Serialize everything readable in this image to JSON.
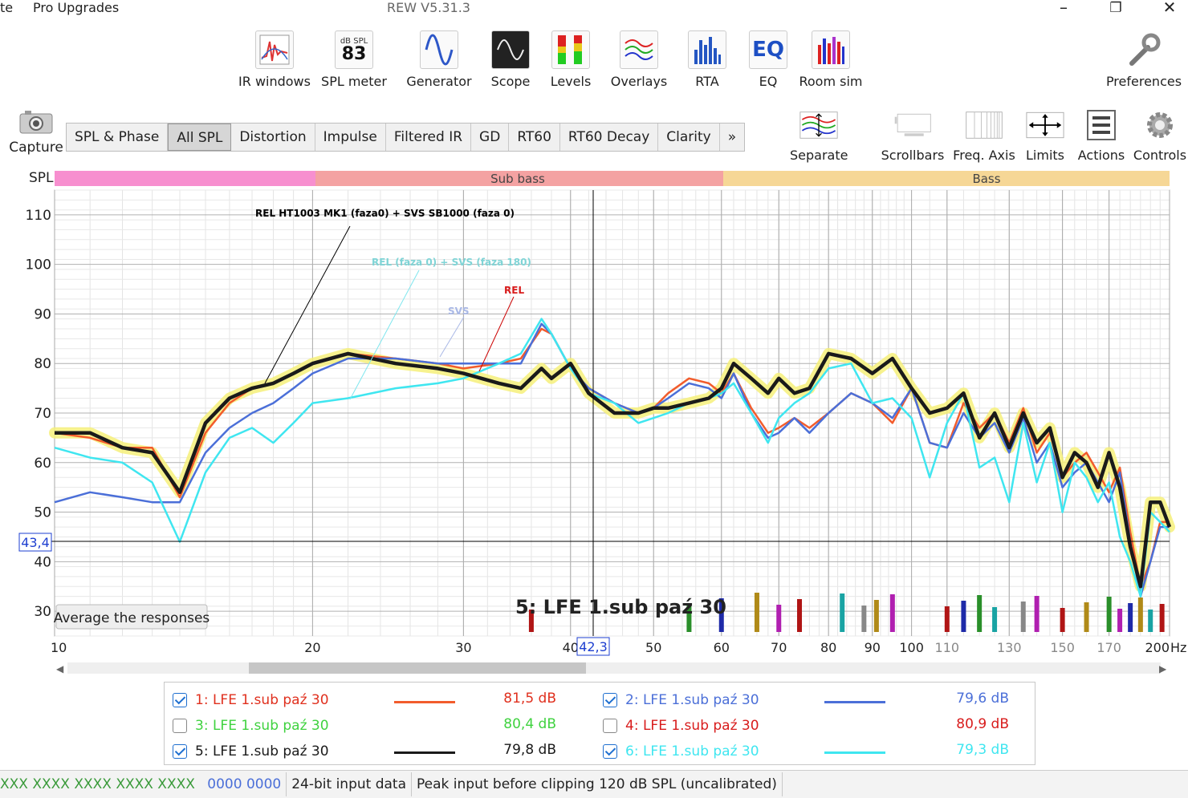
{
  "window": {
    "title": "REW V5.31.3",
    "menu": [
      "te",
      "Pro Upgrades"
    ],
    "controls": {
      "minimize": "–",
      "restore": "❐",
      "close": "✕"
    }
  },
  "toolbar": [
    {
      "label": "IR windows",
      "icon": "ir-windows-icon"
    },
    {
      "label": "SPL meter",
      "icon": "spl-meter-icon",
      "badge_top": "dB SPL",
      "badge_value": "83"
    },
    {
      "label": "Generator",
      "icon": "generator-icon"
    },
    {
      "label": "Scope",
      "icon": "scope-icon"
    },
    {
      "label": "Levels",
      "icon": "levels-icon"
    },
    {
      "label": "Overlays",
      "icon": "overlays-icon"
    },
    {
      "label": "RTA",
      "icon": "rta-icon"
    },
    {
      "label": "EQ",
      "icon": "eq-icon",
      "badge_value": "EQ"
    },
    {
      "label": "Room sim",
      "icon": "room-sim-icon"
    }
  ],
  "preferences_label": "Preferences",
  "capture_label": "Capture",
  "tabs": [
    "SPL & Phase",
    "All SPL",
    "Distortion",
    "Impulse",
    "Filtered IR",
    "GD",
    "RT60",
    "RT60 Decay",
    "Clarity",
    "»"
  ],
  "active_tab": "All SPL",
  "right_tools": [
    {
      "label": "Separate",
      "icon": "separate-icon"
    },
    {
      "label": "Scrollbars",
      "icon": "scrollbars-icon"
    },
    {
      "label": "Freq. Axis",
      "icon": "freq-axis-icon"
    },
    {
      "label": "Limits",
      "icon": "limits-icon"
    },
    {
      "label": "Actions",
      "icon": "actions-icon"
    },
    {
      "label": "Controls",
      "icon": "controls-icon"
    }
  ],
  "graph": {
    "y_axis_title": "SPL",
    "bands": [
      {
        "label": "",
        "color": "#f78fcf"
      },
      {
        "label": "Sub bass",
        "color": "#f4a2a2"
      },
      {
        "label": "Bass",
        "color": "#f6d796"
      }
    ],
    "cursor_y": "43,4",
    "cursor_x": "42,3",
    "average_button": "Average the responses",
    "trace_label": "5: LFE 1.sub paź 30",
    "annotations": [
      {
        "text": "REL HT1003 MK1 (faza0) + SVS SB1000 (faza 0)",
        "color": "#000000"
      },
      {
        "text": "REL (faza 0) + SVS (faza 180)",
        "color": "#7fd4d6"
      },
      {
        "text": "SVS",
        "color": "#a9b8e6"
      },
      {
        "text": "REL",
        "color": "#d81c1c"
      }
    ],
    "hz_unit": "Hz"
  },
  "chart_data": {
    "type": "line",
    "xlabel": "",
    "ylabel": "SPL",
    "x_scale": "log",
    "xlim": [
      10,
      200
    ],
    "ylim": [
      25,
      115
    ],
    "x_ticks": [
      {
        "v": 10,
        "label": "10"
      },
      {
        "v": 20,
        "label": "20"
      },
      {
        "v": 30,
        "label": "30"
      },
      {
        "v": 40,
        "label": "40"
      },
      {
        "v": 50,
        "label": "50"
      },
      {
        "v": 60,
        "label": "60"
      },
      {
        "v": 70,
        "label": "70"
      },
      {
        "v": 80,
        "label": "80"
      },
      {
        "v": 90,
        "label": "90"
      },
      {
        "v": 100,
        "label": "100"
      },
      {
        "v": 110,
        "label": "110"
      },
      {
        "v": 130,
        "label": "130"
      },
      {
        "v": 150,
        "label": "150"
      },
      {
        "v": 170,
        "label": "170"
      },
      {
        "v": 200,
        "label": "200"
      }
    ],
    "y_ticks": [
      30,
      40,
      50,
      60,
      70,
      80,
      90,
      100,
      110
    ],
    "grid": true,
    "series": [
      {
        "name": "1: LFE 1.sub paź 30",
        "color": "#f25c2c",
        "x": [
          10,
          11,
          12,
          13,
          14,
          15,
          16,
          17,
          18,
          19,
          20,
          22,
          25,
          28,
          30,
          33,
          35,
          37,
          38,
          40,
          42,
          45,
          48,
          50,
          52,
          55,
          58,
          60,
          62,
          65,
          68,
          70,
          73,
          76,
          80,
          85,
          90,
          95,
          100,
          105,
          110,
          115,
          120,
          125,
          130,
          135,
          140,
          145,
          150,
          155,
          160,
          165,
          170,
          175,
          180,
          185,
          190,
          195,
          200
        ],
        "y": [
          66,
          65,
          63,
          63,
          53,
          66,
          72,
          75,
          76,
          78,
          80,
          82,
          81,
          80,
          79,
          80,
          81,
          87,
          86,
          79,
          75,
          72,
          70,
          71,
          74,
          77,
          76,
          74,
          78,
          71,
          66,
          67,
          69,
          67,
          70,
          74,
          72,
          68,
          75,
          64,
          63,
          72,
          67,
          70,
          64,
          71,
          62,
          66,
          57,
          60,
          62,
          58,
          54,
          59,
          46,
          35,
          40,
          48,
          48
        ]
      },
      {
        "name": "2: LFE 1.sub paź 30",
        "color": "#4b6fd8",
        "x": [
          10,
          11,
          12,
          13,
          14,
          15,
          16,
          17,
          18,
          19,
          20,
          22,
          25,
          28,
          30,
          33,
          35,
          37,
          38,
          40,
          42,
          45,
          48,
          50,
          52,
          55,
          58,
          60,
          62,
          65,
          68,
          70,
          73,
          76,
          80,
          85,
          90,
          95,
          100,
          105,
          110,
          115,
          120,
          125,
          130,
          135,
          140,
          145,
          150,
          155,
          160,
          165,
          170,
          175,
          180,
          185,
          190,
          195,
          200
        ],
        "y": [
          52,
          54,
          53,
          52,
          52,
          62,
          67,
          70,
          72,
          75,
          78,
          81,
          81,
          80,
          80,
          80,
          80,
          88,
          86,
          79,
          75,
          72,
          70,
          71,
          73,
          76,
          75,
          73,
          78,
          70,
          65,
          66,
          69,
          66,
          70,
          74,
          72,
          69,
          75,
          64,
          63,
          70,
          65,
          68,
          62,
          69,
          60,
          64,
          55,
          58,
          60,
          56,
          52,
          58,
          44,
          33,
          40,
          47,
          47
        ]
      },
      {
        "name": "3: LFE 1.sub paź 30",
        "color": "#3fd23f",
        "hidden": true,
        "x": [],
        "y": []
      },
      {
        "name": "4: LFE 1.sub paź 30",
        "color": "#d81c1c",
        "hidden": true,
        "x": [],
        "y": []
      },
      {
        "name": "5: LFE 1.sub paź 30",
        "color": "#1a1a1a",
        "x": [
          10,
          11,
          12,
          13,
          14,
          15,
          16,
          17,
          18,
          19,
          20,
          22,
          25,
          28,
          30,
          33,
          35,
          37,
          38,
          40,
          42,
          45,
          48,
          50,
          52,
          55,
          58,
          60,
          62,
          65,
          68,
          70,
          73,
          76,
          80,
          85,
          90,
          95,
          100,
          105,
          110,
          115,
          120,
          125,
          130,
          135,
          140,
          145,
          150,
          155,
          160,
          165,
          170,
          175,
          180,
          185,
          190,
          195,
          200
        ],
        "y": [
          66,
          66,
          63,
          62,
          54,
          68,
          73,
          75,
          76,
          78,
          80,
          82,
          80,
          79,
          78,
          76,
          75,
          79,
          77,
          80,
          74,
          70,
          70,
          71,
          71,
          72,
          73,
          75,
          80,
          77,
          74,
          77,
          74,
          75,
          82,
          81,
          78,
          81,
          75,
          70,
          71,
          74,
          65,
          70,
          63,
          70,
          64,
          67,
          57,
          62,
          60,
          55,
          62,
          55,
          43,
          35,
          52,
          52,
          47
        ]
      },
      {
        "name": "6: LFE 1.sub paź 30",
        "color": "#3fe6f0",
        "x": [
          10,
          11,
          12,
          13,
          14,
          15,
          16,
          17,
          18,
          19,
          20,
          22,
          25,
          28,
          30,
          33,
          35,
          37,
          38,
          40,
          42,
          45,
          48,
          50,
          52,
          55,
          58,
          60,
          62,
          65,
          68,
          70,
          73,
          76,
          80,
          85,
          90,
          95,
          100,
          105,
          110,
          115,
          120,
          125,
          130,
          135,
          140,
          145,
          150,
          155,
          160,
          165,
          170,
          175,
          180,
          185,
          190,
          195,
          200
        ],
        "y": [
          63,
          61,
          60,
          56,
          44,
          58,
          65,
          67,
          64,
          68,
          72,
          73,
          75,
          76,
          77,
          80,
          82,
          89,
          86,
          79,
          74,
          72,
          68,
          69,
          70,
          72,
          73,
          74,
          76,
          70,
          64,
          69,
          72,
          74,
          79,
          80,
          72,
          73,
          69,
          57,
          68,
          74,
          59,
          61,
          52,
          68,
          56,
          64,
          50,
          60,
          57,
          52,
          56,
          45,
          40,
          33,
          50,
          48,
          46
        ]
      }
    ]
  },
  "legend": [
    {
      "label": "1: LFE 1.sub paź 30",
      "value": "81,5 dB",
      "checked": true,
      "color": "#f25c2c",
      "text_color": "#e0301e"
    },
    {
      "label": "2: LFE 1.sub paź 30",
      "value": "79,6 dB",
      "checked": true,
      "color": "#4b6fd8",
      "text_color": "#4b6fd8"
    },
    {
      "label": "3: LFE 1.sub paź 30",
      "value": "80,4 dB",
      "checked": false,
      "color": "#3fd23f",
      "text_color": "#3fd23f"
    },
    {
      "label": "4: LFE 1.sub paź 30",
      "value": "80,9 dB",
      "checked": false,
      "color": "#d81c1c",
      "text_color": "#d81c1c"
    },
    {
      "label": "5: LFE 1.sub paź 30",
      "value": "79,8 dB",
      "checked": true,
      "color": "#1a1a1a",
      "text_color": "#1a1a1a"
    },
    {
      "label": "6: LFE 1.sub paź 30",
      "value": "79,3 dB",
      "checked": true,
      "color": "#3fe6f0",
      "text_color": "#3fe6f0"
    }
  ],
  "status": {
    "cell1": "XXX XXXX XXXX  XXXX XXXX",
    "cell1b": "0000 0000",
    "cell2": "24-bit input data",
    "cell3": "Peak input before clipping 120 dB SPL (uncalibrated)"
  }
}
